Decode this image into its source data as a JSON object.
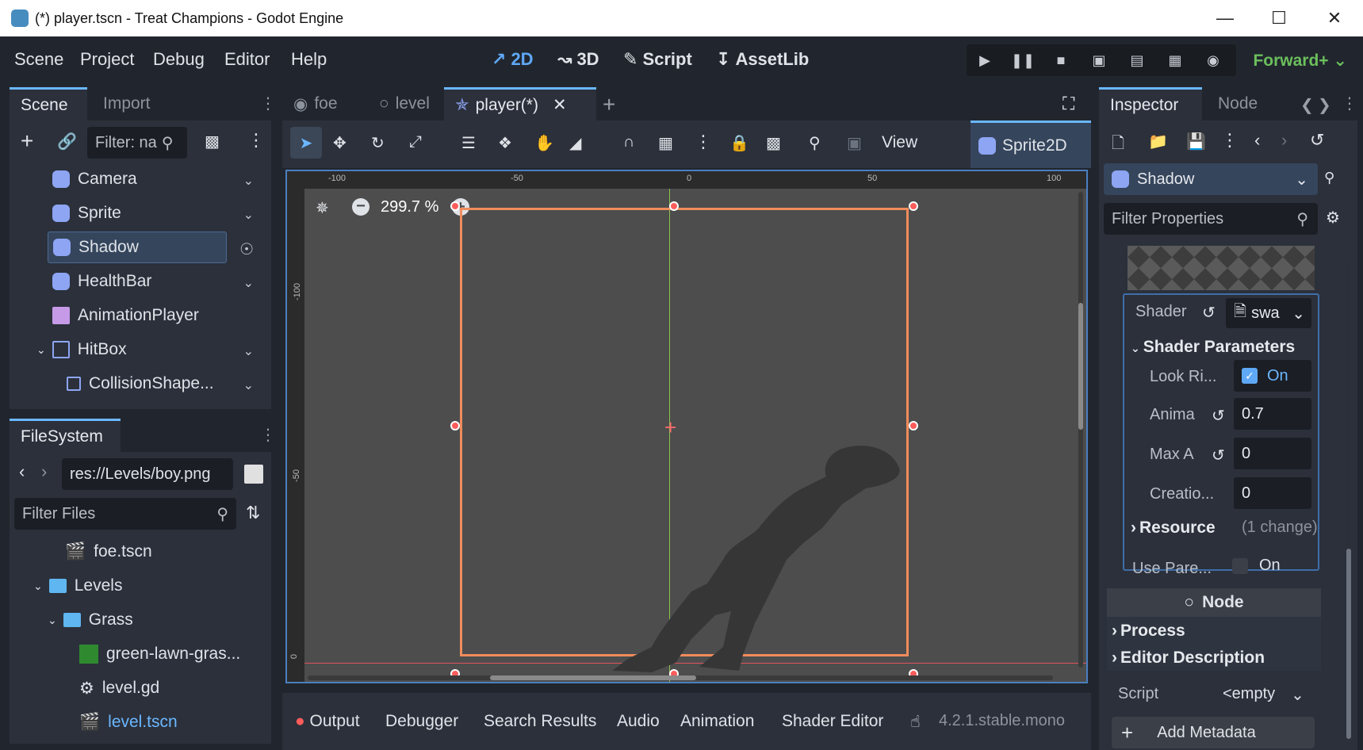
{
  "window": {
    "title": "(*) player.tscn - Treat Champions - Godot Engine"
  },
  "menu": {
    "items": [
      "Scene",
      "Project",
      "Debug",
      "Editor",
      "Help"
    ]
  },
  "workspaces": {
    "w2d": "2D",
    "w3d": "3D",
    "script": "Script",
    "assetlib": "AssetLib"
  },
  "renderer": "Forward+",
  "scene_dock": {
    "tabs": [
      "Scene",
      "Import"
    ],
    "filter_placeholder": "Filter: na",
    "nodes": [
      "Camera",
      "Sprite",
      "Shadow",
      "HealthBar",
      "AnimationPlayer",
      "HitBox",
      "CollisionShape..."
    ]
  },
  "filesystem": {
    "tab": "FileSystem",
    "path": "res://Levels/boy.png",
    "filter_placeholder": "Filter Files",
    "items": [
      "foe.tscn",
      "Levels",
      "Grass",
      "green-lawn-gras...",
      "level.gd",
      "level.tscn"
    ]
  },
  "editor_tabs": [
    "foe",
    "level",
    "player(*)"
  ],
  "toolbar": {
    "view": "View",
    "node_type": "Sprite2D"
  },
  "viewport": {
    "zoom": "299.7 %",
    "ruler_top": [
      "-100",
      "-50",
      "0",
      "50",
      "100"
    ],
    "ruler_left": [
      "-100",
      "-50",
      "0"
    ]
  },
  "bottom": {
    "tabs": [
      "Output",
      "Debugger",
      "Search Results",
      "Audio",
      "Animation",
      "Shader Editor"
    ],
    "version": "4.2.1.stable.mono"
  },
  "inspector": {
    "tabs": [
      "Inspector",
      "Node"
    ],
    "node_name": "Shadow",
    "filter_placeholder": "Filter Properties",
    "shader_label": "Shader",
    "shader_value": "swa",
    "shader_params": "Shader Parameters",
    "look_label": "Look Ri...",
    "look_value": "On",
    "anima_label": "Anima",
    "anima_value": "0.7",
    "maxa_label": "Max A",
    "maxa_value": "0",
    "creatio_label": "Creatio...",
    "creatio_value": "0",
    "resource_label": "Resource",
    "resource_changes": "(1 change)",
    "use_parent_label": "Use Pare...",
    "use_parent_value": "On",
    "node_section": "Node",
    "process": "Process",
    "editor_description": "Editor Description",
    "script_label": "Script",
    "script_value": "<empty",
    "add_metadata": "Add Metadata"
  }
}
